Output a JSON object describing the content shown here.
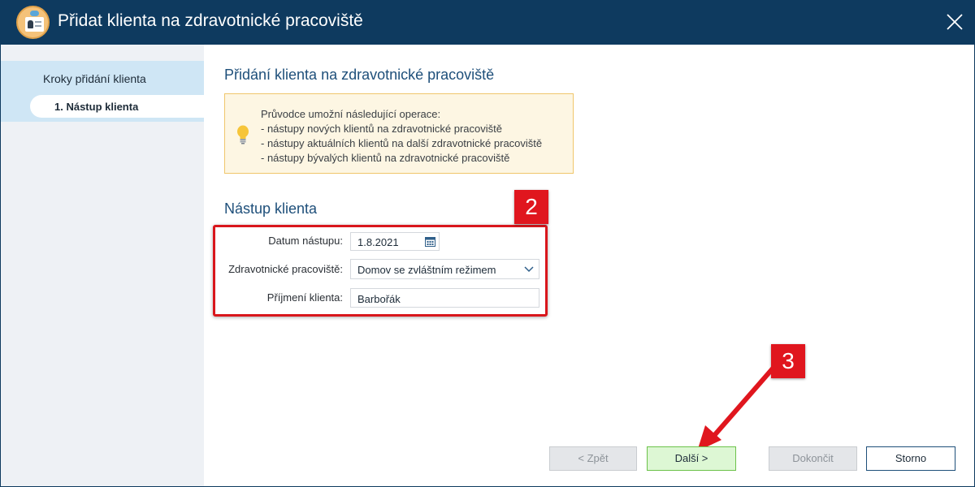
{
  "window": {
    "title": "Přidat klienta na zdravotnické pracoviště"
  },
  "sidebar": {
    "heading": "Kroky přidání klienta",
    "steps": [
      {
        "label": "1. Nástup klienta"
      }
    ]
  },
  "main": {
    "page_title": "Přidání klienta na zdravotnické pracoviště",
    "info": {
      "lines": [
        "Průvodce umožní následující operace:",
        "- nástupy nových klientů na zdravotnické pracoviště",
        "- nástupy aktuálních klientů na další zdravotnické pracoviště",
        "- nástupy bývalých klientů na zdravotnické pracoviště"
      ]
    },
    "section_title": "Nástup klienta",
    "form": {
      "date_label": "Datum nástupu:",
      "date_value": "1.8.2021",
      "place_label": "Zdravotnické pracoviště:",
      "place_value": "Domov se zvláštním režimem",
      "surname_label": "Příjmení klienta:",
      "surname_value": "Barbořák"
    }
  },
  "annotations": {
    "badge_2": "2",
    "badge_3": "3"
  },
  "buttons": {
    "back": "< Zpět",
    "next": "Další >",
    "finish": "Dokončit",
    "cancel": "Storno"
  },
  "colors": {
    "titlebar": "#0e3a5f",
    "accent_text": "#1e4f7a",
    "annotation_red": "#e0161e",
    "next_button_bg": "#ddf7d4",
    "info_bg": "#fdf6e3"
  },
  "icons": {
    "app": "client-card-icon",
    "close": "close-icon",
    "info": "lightbulb-icon",
    "date": "calendar-icon",
    "dropdown": "chevron-down-icon"
  }
}
